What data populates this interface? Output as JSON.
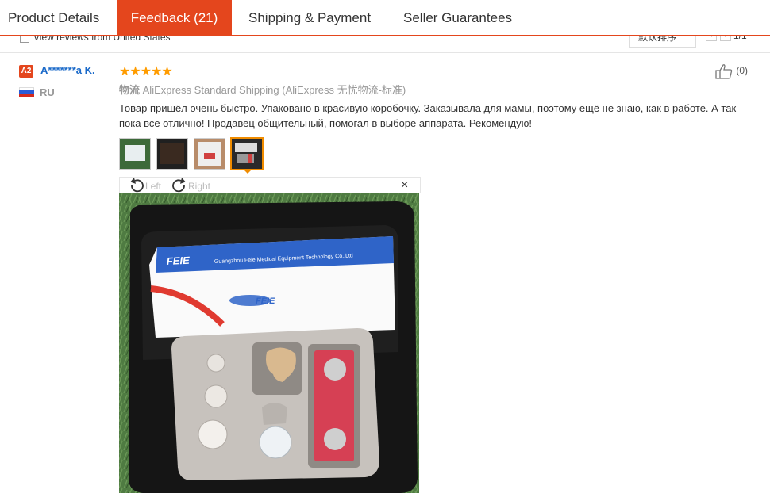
{
  "tabs": [
    {
      "label": "Product Details",
      "active": false
    },
    {
      "label": "Feedback (21)",
      "active": true
    },
    {
      "label": "Shipping & Payment",
      "active": false
    },
    {
      "label": "Seller Guarantees",
      "active": false
    }
  ],
  "filter": {
    "label": "View reviews from United States",
    "sort_label": "默认排序",
    "page_label": "1/1"
  },
  "review": {
    "level_badge": "A2",
    "reviewer": "A*******a K.",
    "stars": "★★★★★",
    "rating": 5,
    "country": "RU",
    "shipping_label": "物流",
    "shipping_method": "AliExpress Standard Shipping (AliExpress 无忧物流-标准)",
    "text": "Товар пришёл очень быстро. Упаковано в красивую коробочку. Заказывала для мамы, поэтому ещё не знаю, как в работе. А так пока все отлично! Продавец общительный, помогал в выборе аппарата. Рекомендую!",
    "helpful_count": "(0)"
  },
  "viewer": {
    "rotate_left": "Left",
    "rotate_right": "Right",
    "close": "×",
    "brand_text": "FEIE",
    "box_text": "Guangzhou Feie Medical Equipment Technology Co.,Ltd"
  },
  "colors": {
    "accent": "#e4461d",
    "link": "#1b6ac9",
    "star": "#ff9c00",
    "thumb_selected": "#f08c00"
  }
}
